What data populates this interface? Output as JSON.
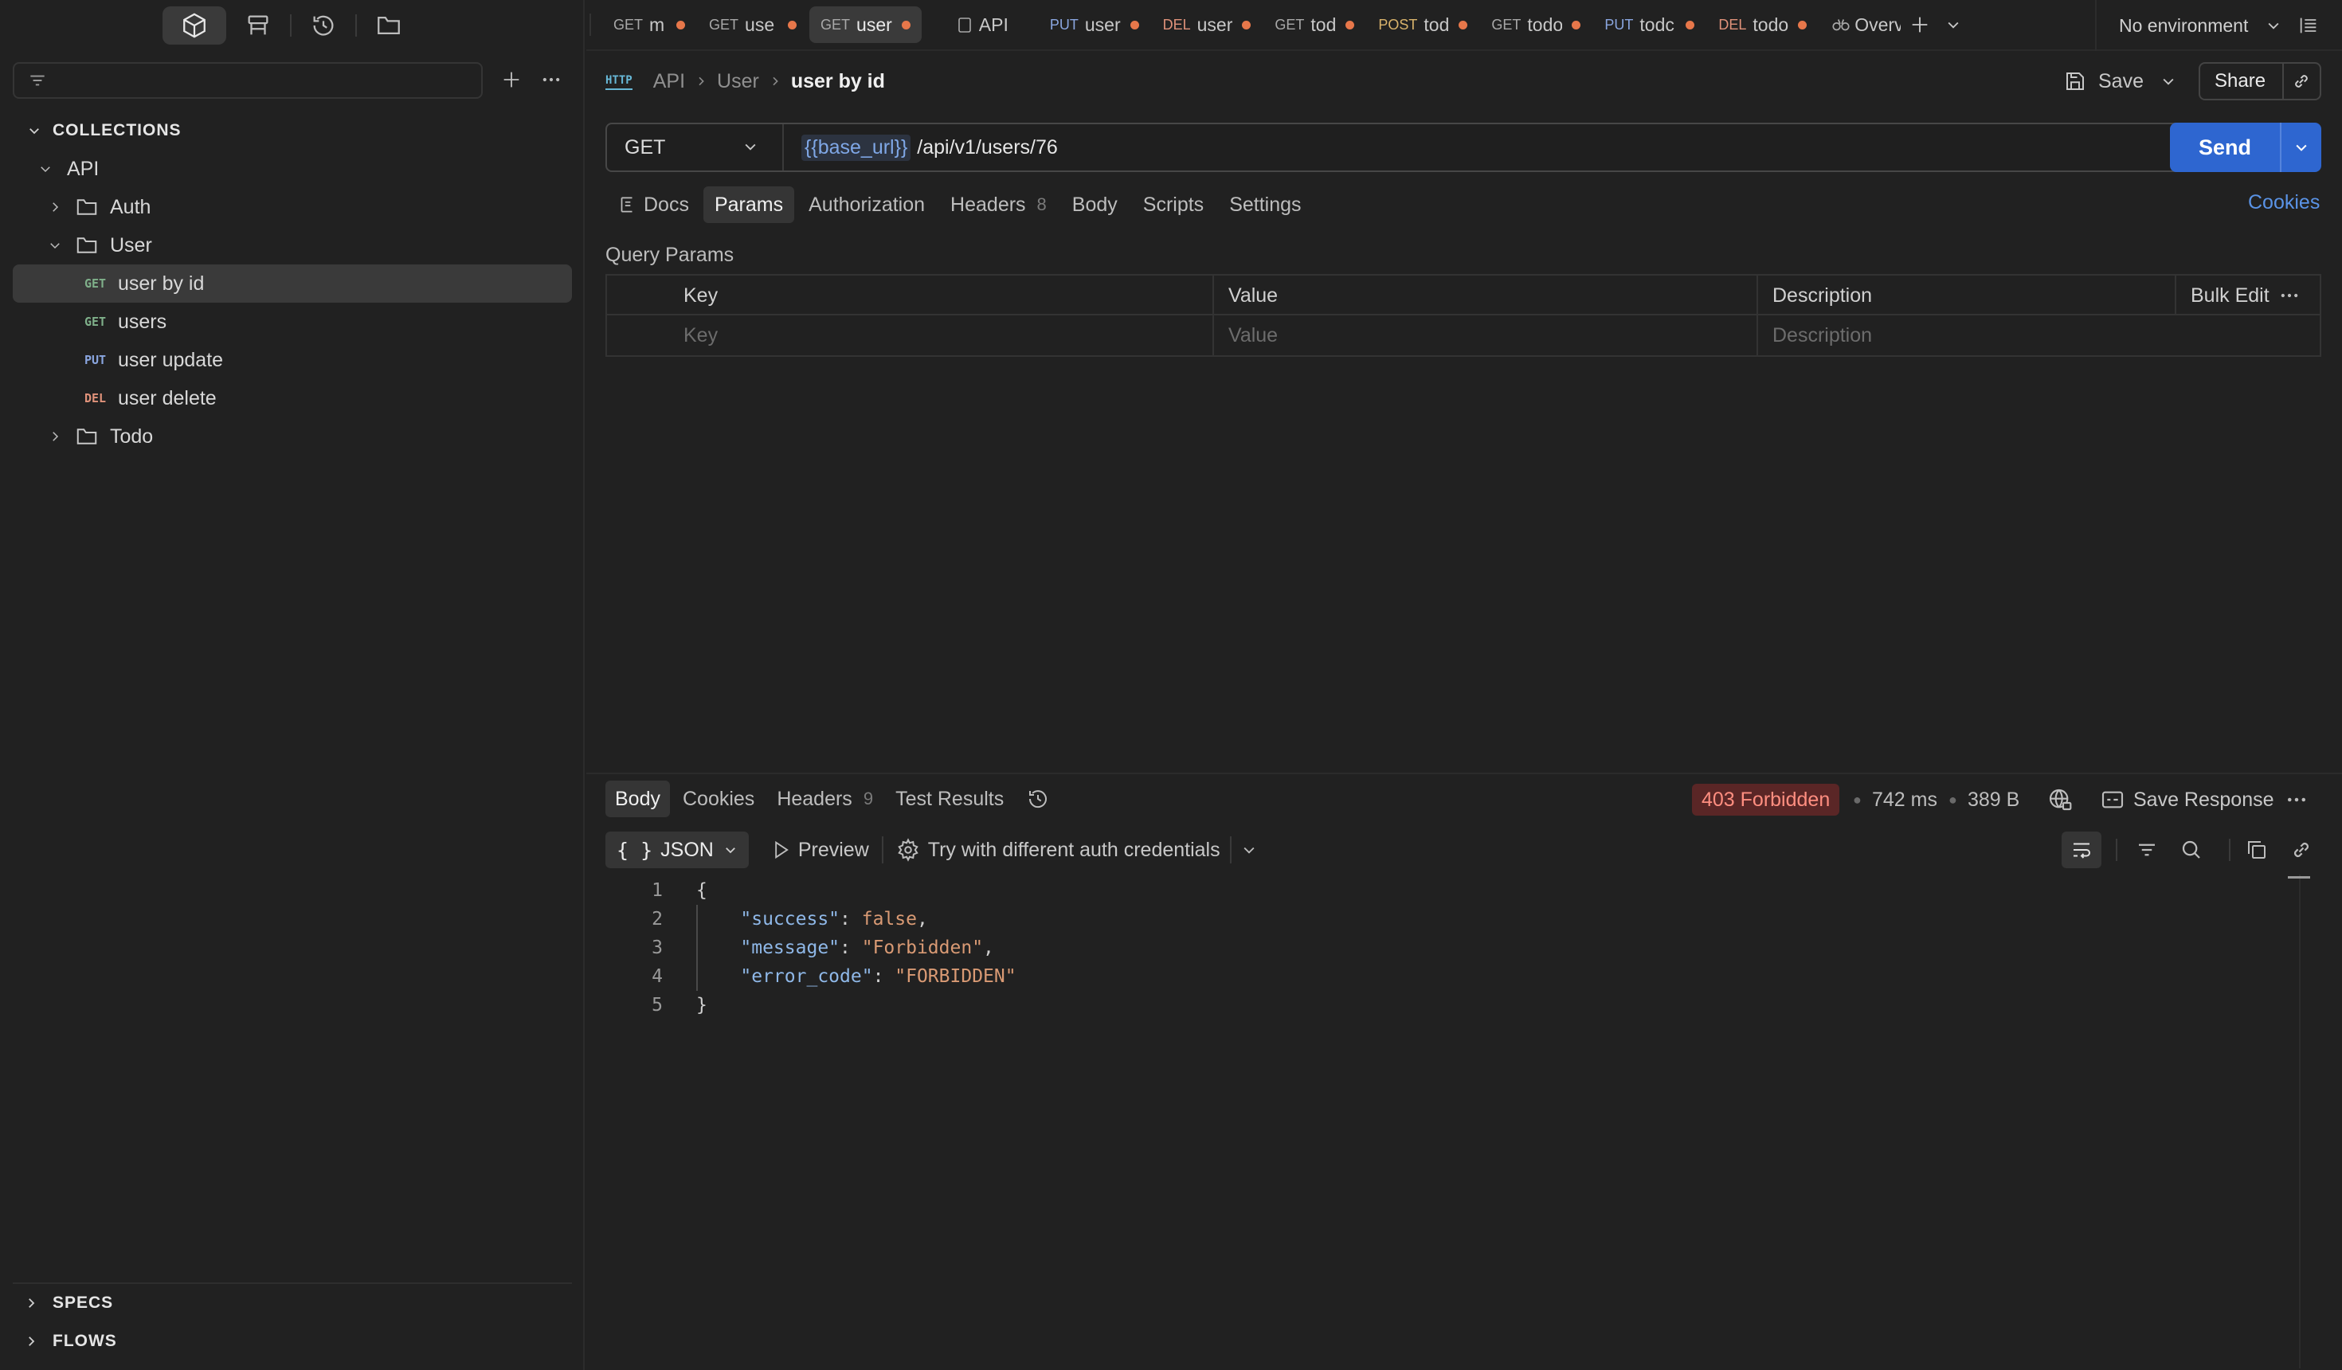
{
  "sidebar": {
    "filter_placeholder": "",
    "sections": {
      "collections": "COLLECTIONS",
      "specs": "SPECS",
      "flows": "FLOWS"
    },
    "tree": {
      "api": "API",
      "auth": "Auth",
      "user": "User",
      "requests": [
        {
          "method": "GET",
          "label": "user by id"
        },
        {
          "method": "GET",
          "label": "users"
        },
        {
          "method": "PUT",
          "label": "user update"
        },
        {
          "method": "DEL",
          "label": "user delete"
        }
      ],
      "todo": "Todo"
    }
  },
  "tabs": [
    {
      "method": "GET",
      "name": "m"
    },
    {
      "method": "GET",
      "name": "use"
    },
    {
      "method": "GET",
      "name": "user"
    },
    {
      "method": "",
      "name": "API"
    },
    {
      "method": "PUT",
      "name": "user"
    },
    {
      "method": "DEL",
      "name": "user"
    },
    {
      "method": "GET",
      "name": "tod"
    },
    {
      "method": "POST",
      "name": "tod"
    },
    {
      "method": "GET",
      "name": "todo"
    },
    {
      "method": "PUT",
      "name": "todc"
    },
    {
      "method": "DEL",
      "name": "todo"
    },
    {
      "method": "",
      "name": "Overv"
    }
  ],
  "environment": "No environment",
  "breadcrumb": {
    "badge": "HTTP",
    "items": [
      "API",
      "User"
    ],
    "current": "user by id"
  },
  "header": {
    "save": "Save",
    "share": "Share"
  },
  "request": {
    "method": "GET",
    "url_var": "{{base_url}}",
    "url_path": "/api/v1/users/76",
    "send": "Send"
  },
  "request_tabs": {
    "docs": "Docs",
    "params": "Params",
    "authorization": "Authorization",
    "headers": "Headers",
    "headers_count": "8",
    "body": "Body",
    "scripts": "Scripts",
    "settings": "Settings",
    "cookies": "Cookies"
  },
  "query_params": {
    "title": "Query Params",
    "columns": [
      "Key",
      "Value",
      "Description"
    ],
    "bulk_edit": "Bulk Edit",
    "placeholders": {
      "key": "Key",
      "value": "Value",
      "description": "Description"
    }
  },
  "response": {
    "tabs": {
      "body": "Body",
      "cookies": "Cookies",
      "headers": "Headers",
      "headers_count": "9",
      "test_results": "Test Results"
    },
    "status": "403 Forbidden",
    "time": "742 ms",
    "size": "389 B",
    "save_response": "Save Response",
    "format": "JSON",
    "preview": "Preview",
    "auth_hint": "Try with different auth credentials",
    "lines": [
      {
        "n": "1",
        "text": "{"
      },
      {
        "n": "2",
        "key": "\"success\"",
        "val": "false",
        "tail": ","
      },
      {
        "n": "3",
        "key": "\"message\"",
        "val": "\"Forbidden\"",
        "tail": ","
      },
      {
        "n": "4",
        "key": "\"error_code\"",
        "val": "\"FORBIDDEN\"",
        "tail": ""
      },
      {
        "n": "5",
        "text": "}"
      }
    ]
  },
  "colors": {
    "accent": "#2e66d0",
    "status_error_bg": "#5a2626",
    "status_error_text": "#ff8e80",
    "unsaved_dot": "#e7774a"
  }
}
